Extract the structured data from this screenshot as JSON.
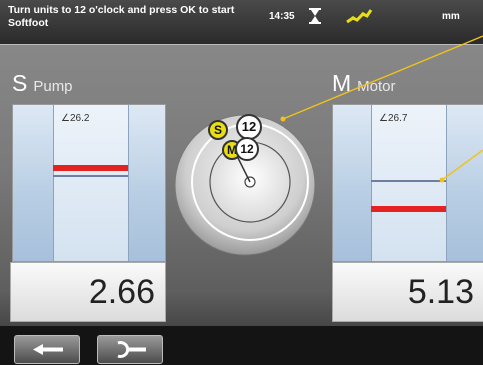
{
  "status": {
    "message": "Turn units to 12 o'clock and press OK to start Softfoot",
    "time": "14:35",
    "unit": "mm",
    "icons": [
      "hourglass-icon",
      "signal-icon"
    ]
  },
  "pump": {
    "letter": "S",
    "name": "Pump",
    "angle": "26.2",
    "value": "2.66"
  },
  "motor": {
    "letter": "M",
    "name": "Motor",
    "angle": "26.7",
    "value": "5.13"
  },
  "dial": {
    "s_label": "S",
    "m_label": "M",
    "top_label": "12",
    "second_label": "12"
  },
  "buttons": {
    "back_icon": "arrow-left-icon",
    "ok_icon": "confirm-icon"
  },
  "colors": {
    "accent_yellow": "#e8dd16",
    "measure_red": "#e52222",
    "leader_line": "#f0c21a"
  }
}
